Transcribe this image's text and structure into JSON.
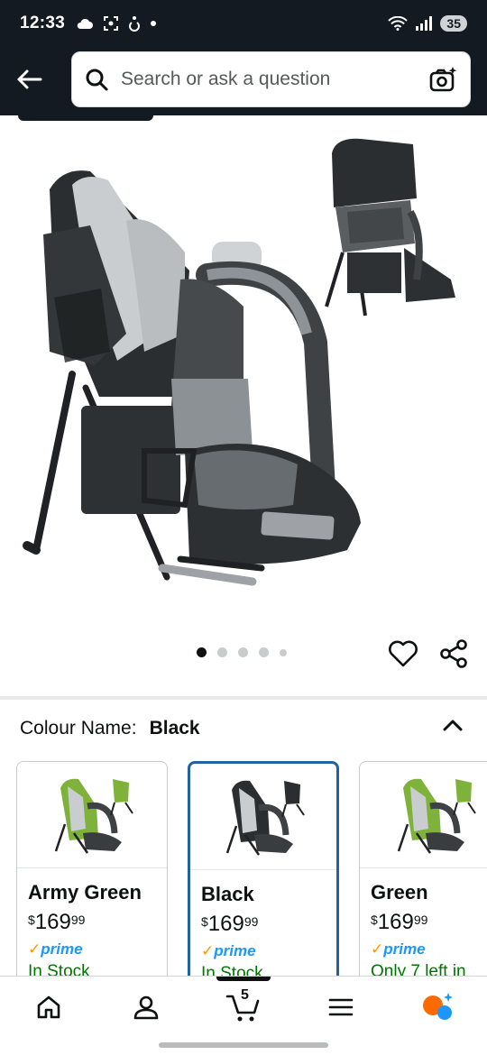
{
  "status_bar": {
    "time": "12:33",
    "battery": "35"
  },
  "header": {
    "search_placeholder": "Search or ask a question"
  },
  "gallery": {
    "image_count": 5,
    "active_index": 0
  },
  "colour": {
    "label": "Colour Name:",
    "selected": "Black"
  },
  "swatches": [
    {
      "name": "Army Green",
      "currency": "$",
      "price_whole": "169",
      "price_frac": "99",
      "prime": "prime",
      "stock": "In Stock",
      "accent": "#7fb23a",
      "selected": false
    },
    {
      "name": "Black",
      "currency": "$",
      "price_whole": "169",
      "price_frac": "99",
      "prime": "prime",
      "stock": "In Stock",
      "accent": "#3a3d40",
      "selected": true
    },
    {
      "name": "Green",
      "currency": "$",
      "price_whole": "169",
      "price_frac": "99",
      "prime": "prime",
      "stock": "Only 7 left in",
      "accent": "#7fb23a",
      "selected": false
    }
  ],
  "bottom_nav": {
    "items": [
      "home-icon",
      "account-icon",
      "cart-icon",
      "menu-icon",
      "assistant-icon"
    ],
    "cart_count": "5"
  },
  "colors": {
    "brand_dark": "#131a22",
    "link_blue": "#2162a1",
    "stock_green": "#007600",
    "prime_blue": "#1a98ff"
  }
}
